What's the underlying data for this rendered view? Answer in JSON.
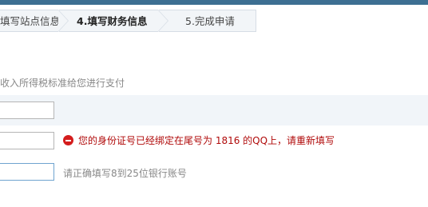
{
  "steps": [
    {
      "label": "填写站点信息"
    },
    {
      "label": "4.填写财务信息"
    },
    {
      "label": "5.完成申请"
    }
  ],
  "tax_note": "收入所得税标准给您进行支付",
  "fields": {
    "field1": {
      "value": ""
    },
    "id_number": {
      "value": "",
      "error": "您的身份证号已经绑定在尾号为 1816 的QQ上，请重新填写"
    },
    "bank_account": {
      "value": "",
      "hint": "请正确填写8到25位银行账号"
    }
  },
  "colors": {
    "topbar": "#3d6f92",
    "error": "#b00a0a",
    "band": "#f1f5f9"
  }
}
